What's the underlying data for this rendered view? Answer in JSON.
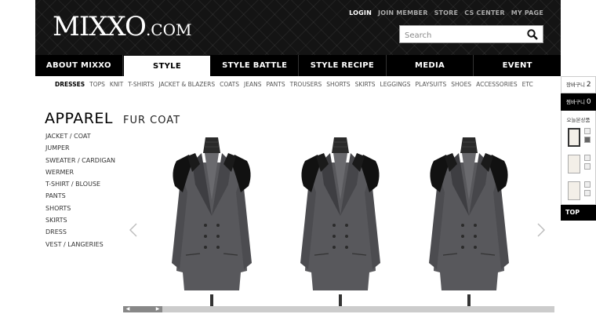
{
  "header": {
    "logo_text": "MIXXO",
    "logo_suffix": ".COM",
    "top_links": [
      "LOGIN",
      "JOIN MEMBER",
      "STORE",
      "CS CENTER",
      "MY PAGE"
    ],
    "search_placeholder": "Search"
  },
  "main_nav": [
    "ABOUT MIXXO",
    "STYLE",
    "STYLE BATTLE",
    "STYLE RECIPE",
    "MEDIA",
    "EVENT"
  ],
  "main_nav_active": "STYLE",
  "sub_nav": [
    "DRESSES",
    "TOPS",
    "KNIT",
    "T-SHIRTS",
    "JACKET & BLAZERS",
    "COATS",
    "JEANS",
    "PANTS",
    "TROUSERS",
    "SHORTS",
    "SKIRTS",
    "LEGGINGS",
    "PLAYSUITS",
    "SHOES",
    "ACCESSORIES",
    "ETC"
  ],
  "sub_nav_active": "DRESSES",
  "sidebar": {
    "title": "APPAREL",
    "items": [
      "JACKET / COAT",
      "JUMPER",
      "SWEATER / CARDIGAN",
      "WERMER",
      "T-SHIRT / BLOUSE",
      "PANTS",
      "SHORTS",
      "SKIRTS",
      "DRESS",
      "VEST / LANGERIES"
    ]
  },
  "content": {
    "section_title": "FUR COAT",
    "products": [
      {
        "name": "fur-coat-1"
      },
      {
        "name": "fur-coat-2"
      },
      {
        "name": "fur-coat-3"
      }
    ]
  },
  "quick_panel": {
    "wishlist_label": "장바구니",
    "wishlist_count": "2",
    "cart_label": "찜바구니",
    "cart_count": "0",
    "recent_title": "오늘본상품",
    "top_label": "TOP"
  },
  "colors": {
    "header_bg": "#141414",
    "nav_bg": "#000000",
    "coat_body": "#5a5a5e",
    "fur": "#111111"
  }
}
